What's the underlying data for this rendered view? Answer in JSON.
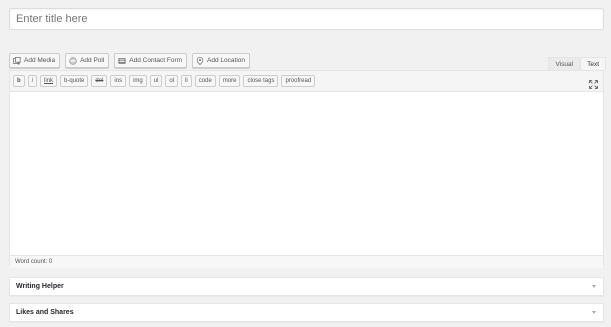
{
  "title_field": {
    "placeholder": "Enter title here",
    "value": ""
  },
  "media_buttons": [
    {
      "label": "Add Media",
      "icon": "media-icon"
    },
    {
      "label": "Add Poll",
      "icon": "poll-icon"
    },
    {
      "label": "Add Contact Form",
      "icon": "contact-form-icon"
    },
    {
      "label": "Add Location",
      "icon": "location-pin-icon"
    }
  ],
  "editor_tabs": {
    "visual": "Visual",
    "text": "Text",
    "active": "Text"
  },
  "quicktags": [
    "b",
    "i",
    "link",
    "b-quote",
    "del",
    "ins",
    "img",
    "ul",
    "ol",
    "li",
    "code",
    "more",
    "close tags",
    "proofread"
  ],
  "editor": {
    "content": "",
    "word_count_label": "Word count: 0"
  },
  "postboxes": [
    {
      "title": "Writing Helper"
    },
    {
      "title": "Likes and Shares"
    }
  ]
}
